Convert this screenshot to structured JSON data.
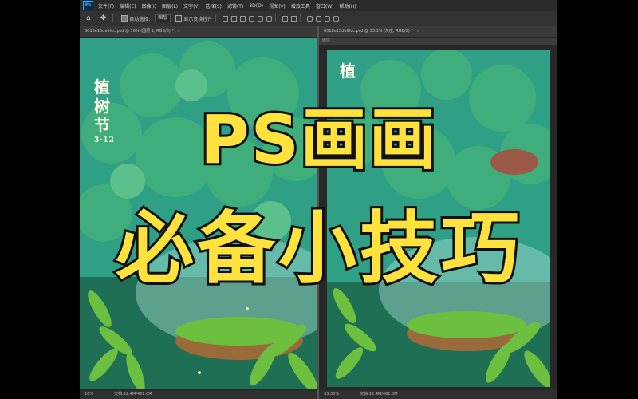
{
  "app": {
    "logo": "Ps",
    "menu": [
      "文件(F)",
      "编辑(E)",
      "图像(I)",
      "图层(L)",
      "文字(Y)",
      "选择(S)",
      "滤镜(T)",
      "3D(D)",
      "视图(V)",
      "增效工具",
      "窗口(W)",
      "帮助(H)"
    ]
  },
  "options_bar": {
    "auto_select_label": "自动选择:",
    "auto_select_value": "图层",
    "show_transform_label": "显示变换控件"
  },
  "documents": [
    {
      "tab": "6018e15de6fcc.psd @ 16% (图层 1, RGB/8) *",
      "zoom": "16%",
      "doc_size": "文档:12.4M/461.0M"
    },
    {
      "tab": "6018e15de6fcc.psd @ 33.3% (灰度, RGB/8) *",
      "ruler": "图层 1",
      "zoom": "33.33%",
      "doc_size": "文档:12.4M/461.0M"
    }
  ],
  "artwork": {
    "title_chars": [
      "植",
      "树",
      "节"
    ],
    "date": "3·12"
  },
  "overlay": {
    "line1": "PS画画",
    "line2": "必备小技巧"
  },
  "colors": {
    "headline_fill": "#ffe23d",
    "headline_stroke": "#111111",
    "art_bg": "#2f9f86",
    "leaf_green": "#6cbf3f"
  }
}
